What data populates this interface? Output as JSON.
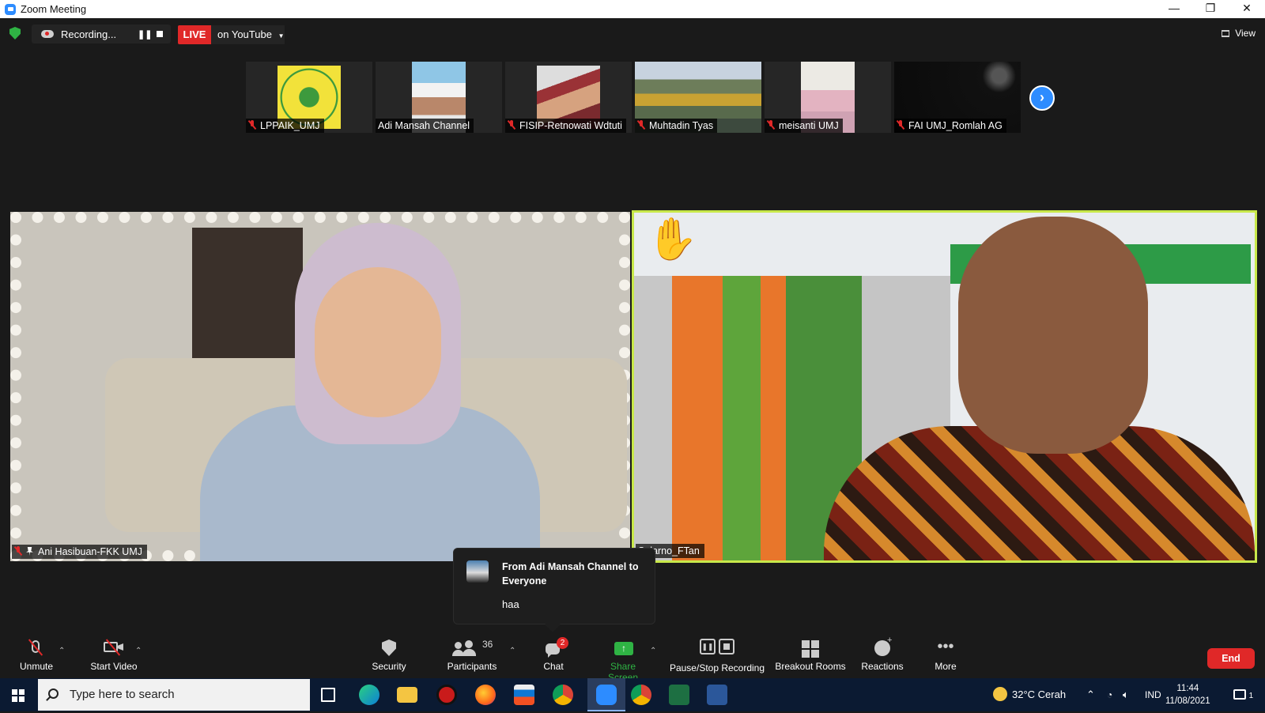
{
  "window": {
    "title": "Zoom Meeting",
    "controls": [
      "—",
      "❐",
      "✕"
    ]
  },
  "topbar": {
    "recording_label": "Recording...",
    "live_label": "LIVE",
    "stream_label": "on YouTube",
    "view_label": "View"
  },
  "thumbnails": [
    {
      "name": "LPPAIK_UMJ",
      "muted": true
    },
    {
      "name": "Adi Mansah Channel",
      "muted": false
    },
    {
      "name": "FISIP-Retnowati Wdtuti",
      "muted": true
    },
    {
      "name": "Muhtadin Tyas",
      "muted": true
    },
    {
      "name": "meisanti UMJ",
      "muted": true
    },
    {
      "name": "FAI UMJ_Romlah AG",
      "muted": true
    }
  ],
  "videos": {
    "left_name": "Ani Hasibuan-FKK UMJ",
    "right_name": "Sularno_FTan"
  },
  "chat_popup": {
    "from": "From Adi Mansah Channel to Everyone",
    "message": "haa"
  },
  "toolbar": {
    "unmute": "Unmute",
    "start_video": "Start Video",
    "security": "Security",
    "participants": "Participants",
    "participants_count": "36",
    "chat": "Chat",
    "chat_badge": "2",
    "share_screen": "Share Screen",
    "recording": "Pause/Stop Recording",
    "breakout": "Breakout Rooms",
    "reactions": "Reactions",
    "more": "More",
    "end": "End"
  },
  "taskbar": {
    "search_placeholder": "Type here to search",
    "weather": "32°C  Cerah",
    "lang": "IND",
    "time": "11:44",
    "date": "11/08/2021",
    "notif_count": "1"
  },
  "colors": {
    "live_red": "#e02828",
    "zoom_blue": "#2d8cff",
    "share_green": "#2fb344",
    "active_speaker": "#c8e84a"
  }
}
